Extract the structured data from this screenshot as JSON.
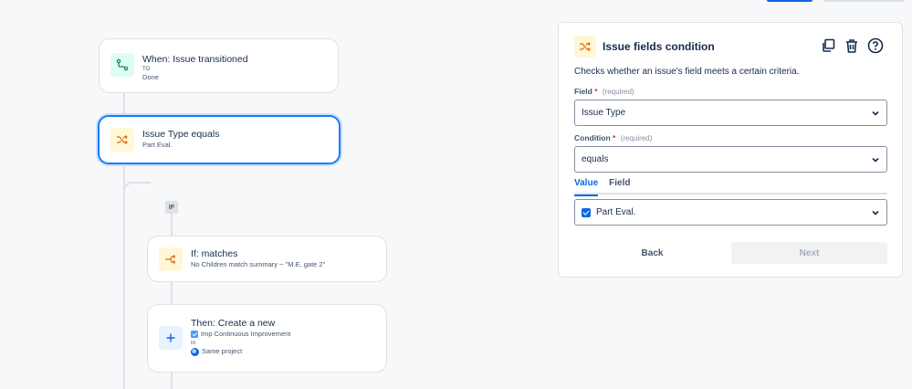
{
  "flow": {
    "trigger": {
      "title": "When: Issue transitioned",
      "sub_label": "TO",
      "sub_value": "Done"
    },
    "condition": {
      "title": "Issue Type equals",
      "sub": "Part Eval."
    },
    "branch_badge": "IF",
    "if_node": {
      "title": "If: matches",
      "sub": "No Children match summary ~ \"M.E. gate 2\""
    },
    "then_node": {
      "title": "Then: Create a new",
      "issue_type": "Imp Continuous Improvement",
      "in_label": "in",
      "project": "Same project"
    }
  },
  "panel": {
    "title": "Issue fields condition",
    "description": "Checks whether an issue's field meets a certain criteria.",
    "field_label": "Field",
    "field_required": "*",
    "field_hint": "(required)",
    "field_value": "Issue Type",
    "condition_label": "Condition",
    "condition_required": "*",
    "condition_hint": "(required)",
    "condition_value": "equals",
    "tabs": [
      "Value",
      "Field"
    ],
    "active_tab": "Value",
    "value_selected": "Part Eval.",
    "back_label": "Back",
    "next_label": "Next"
  },
  "colors": {
    "accent": "#0c66e4",
    "selected_border": "#1d7afc",
    "trigger_icon": "#1f845a",
    "condition_icon": "#e56910",
    "action_icon": "#0c66e4"
  },
  "icons": {
    "trigger": "branch-path-icon",
    "condition": "shuffle-icon",
    "if": "fork-icon",
    "action": "plus-icon",
    "duplicate": "duplicate-icon",
    "delete": "trash-icon",
    "help": "help-icon"
  }
}
